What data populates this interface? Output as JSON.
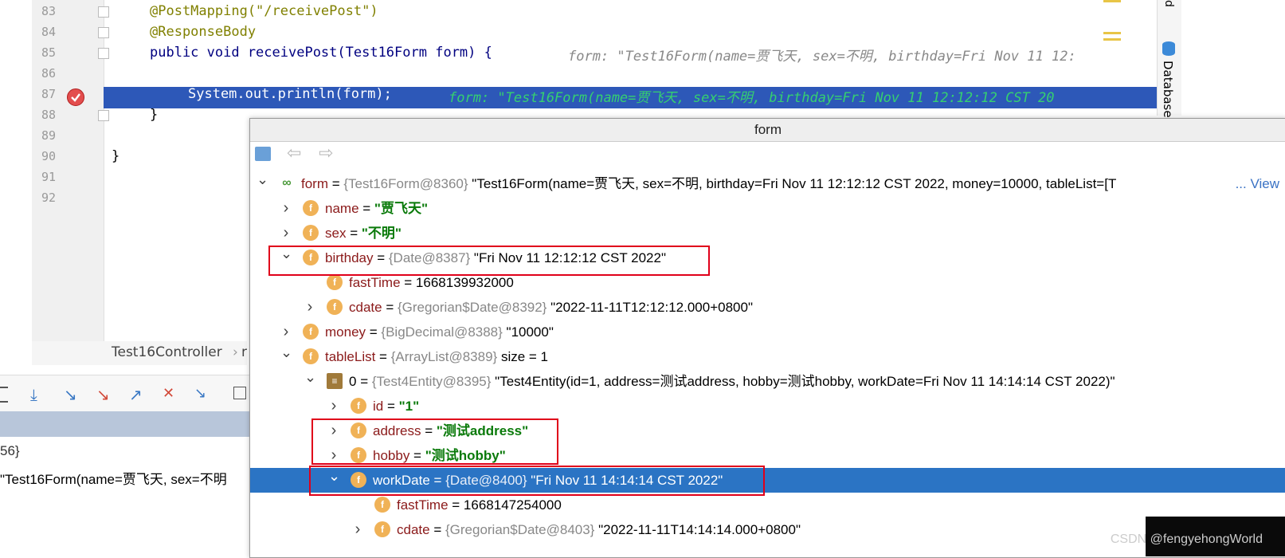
{
  "editor": {
    "lines": [
      {
        "no": "83",
        "text": "@PostMapping(\"/receivePost\")"
      },
      {
        "no": "84",
        "text": "@ResponseBody"
      },
      {
        "no": "85",
        "text": "public void receivePost(Test16Form form) {",
        "hint": "form: \"Test16Form(name=贾飞天, sex=不明, birthday=Fri Nov 11 12:"
      },
      {
        "no": "86",
        "text": ""
      },
      {
        "no": "87",
        "text": "System.out.println(form);",
        "hint": "form: \"Test16Form(name=贾飞天, sex=不明, birthday=Fri Nov 11 12:12:12 CST 20"
      },
      {
        "no": "88",
        "text": "}"
      },
      {
        "no": "89",
        "text": ""
      },
      {
        "no": "90",
        "text": "}"
      },
      {
        "no": "91",
        "text": ""
      },
      {
        "no": "92",
        "text": ""
      }
    ],
    "breadcrumb": "Test16Controller",
    "breadcrumb_tail": "r",
    "right_tab": "Database",
    "right_tab_top": "d"
  },
  "lower_left": {
    "line1": "56}",
    "line2": "\"Test16Form(name=贾飞天, sex=不明"
  },
  "popup": {
    "title": "form",
    "view_link": "... View",
    "rows": [
      {
        "indent": 0,
        "chevron": "open",
        "icon": "watch",
        "name": "form",
        "eq": " = ",
        "ref": "{Test16Form@8360}",
        "val": " \"Test16Form(name=贾飞天, sex=不明, birthday=Fri Nov 11 12:12:12 CST 2022, money=10000, tableList=[T",
        "selected": false
      },
      {
        "indent": 1,
        "chevron": "closed",
        "icon": "f",
        "name": "name",
        "eq": " = ",
        "str": "\"贾飞天\"",
        "selected": false
      },
      {
        "indent": 1,
        "chevron": "closed",
        "icon": "f",
        "name": "sex",
        "eq": " = ",
        "str": "\"不明\"",
        "selected": false
      },
      {
        "indent": 1,
        "chevron": "open",
        "icon": "f",
        "name": "birthday",
        "eq": " = ",
        "ref": "{Date@8387}",
        "val": " \"Fri Nov 11 12:12:12 CST 2022\"",
        "selected": false
      },
      {
        "indent": 2,
        "chevron": "none",
        "icon": "f",
        "name": "fastTime",
        "eq": " = ",
        "val": "1668139932000",
        "selected": false
      },
      {
        "indent": 2,
        "chevron": "closed",
        "icon": "f",
        "name": "cdate",
        "eq": " = ",
        "ref": "{Gregorian$Date@8392}",
        "val": " \"2022-11-11T12:12:12.000+0800\"",
        "selected": false
      },
      {
        "indent": 1,
        "chevron": "closed",
        "icon": "f",
        "name": "money",
        "eq": " = ",
        "ref": "{BigDecimal@8388}",
        "val": " \"10000\"",
        "selected": false
      },
      {
        "indent": 1,
        "chevron": "open",
        "icon": "f",
        "name": "tableList",
        "eq": " = ",
        "ref": "{ArrayList@8389}",
        "val": "  size = 1",
        "selected": false
      },
      {
        "indent": 2,
        "chevron": "open",
        "icon": "list",
        "name": "0",
        "eq": " = ",
        "ref": "{Test4Entity@8395}",
        "val": " \"Test4Entity(id=1, address=测试address, hobby=测试hobby, workDate=Fri Nov 11 14:14:14 CST 2022)\"",
        "selected": false,
        "name_plain": true
      },
      {
        "indent": 3,
        "chevron": "closed",
        "icon": "f",
        "name": "id",
        "eq": " = ",
        "str": "\"1\"",
        "selected": false
      },
      {
        "indent": 3,
        "chevron": "closed",
        "icon": "f",
        "name": "address",
        "eq": " = ",
        "str": "\"测试address\"",
        "selected": false
      },
      {
        "indent": 3,
        "chevron": "closed",
        "icon": "f",
        "name": "hobby",
        "eq": " = ",
        "str": "\"测试hobby\"",
        "selected": false
      },
      {
        "indent": 3,
        "chevron": "open",
        "icon": "f",
        "name": "workDate",
        "eq": " = ",
        "ref": "{Date@8400}",
        "val": " \"Fri Nov 11 14:14:14 CST 2022\"",
        "selected": true
      },
      {
        "indent": 4,
        "chevron": "none",
        "icon": "f",
        "name": "fastTime",
        "eq": " = ",
        "val": "1668147254000",
        "selected": false
      },
      {
        "indent": 4,
        "chevron": "closed",
        "icon": "f",
        "name": "cdate",
        "eq": " = ",
        "ref": "{Gregorian$Date@8403}",
        "val": " \"2022-11-11T14:14:14.000+0800\"",
        "selected": false
      }
    ]
  },
  "watermark": "CSDN @fengyehongWorld",
  "colors": {
    "selection": "#2b74c4",
    "editor_highlight": "#2d58b8",
    "redbox": "#e0001a"
  }
}
